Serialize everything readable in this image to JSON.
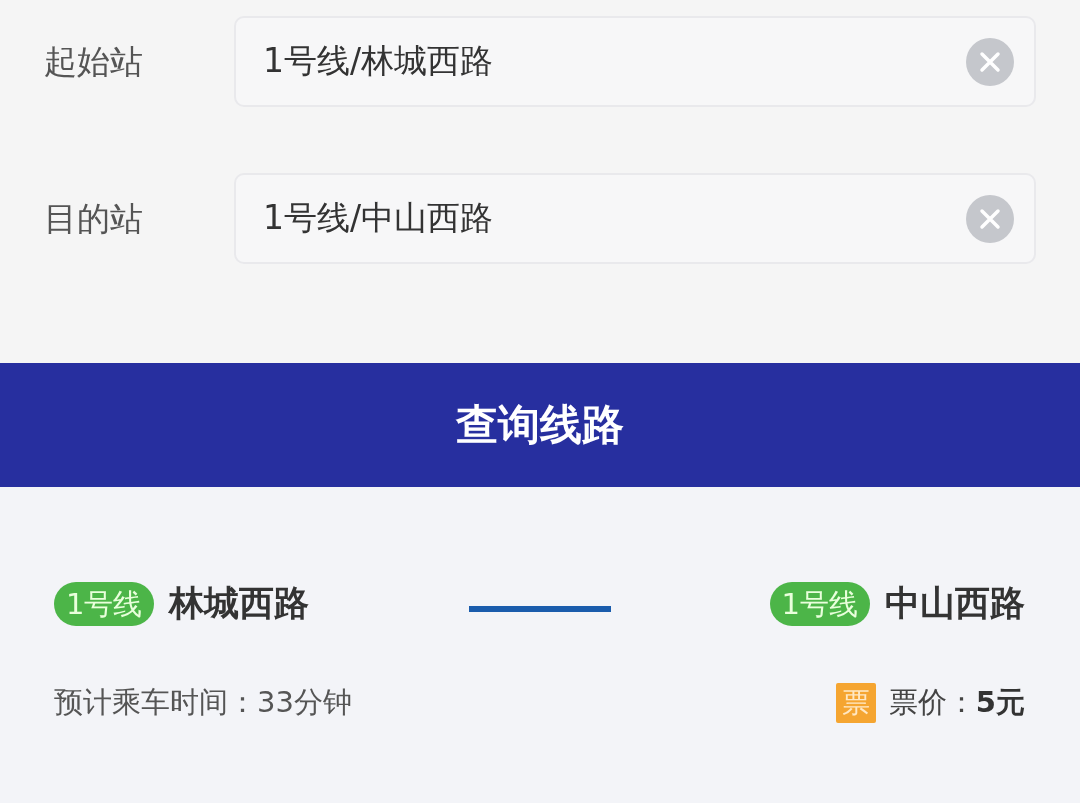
{
  "form": {
    "fields": [
      {
        "label": "起始站",
        "value": "1号线/林城西路"
      },
      {
        "label": "目的站",
        "value": "1号线/中山西路"
      }
    ]
  },
  "query_button": {
    "label": "查询线路"
  },
  "route": {
    "stops": [
      {
        "line": "1号线",
        "station": "林城西路"
      },
      {
        "line": "1号线",
        "station": "中山西路"
      }
    ],
    "duration": "预计乘车时间：33分钟",
    "fare": {
      "badge": "票",
      "text": "票价：**5元**"
    }
  }
}
